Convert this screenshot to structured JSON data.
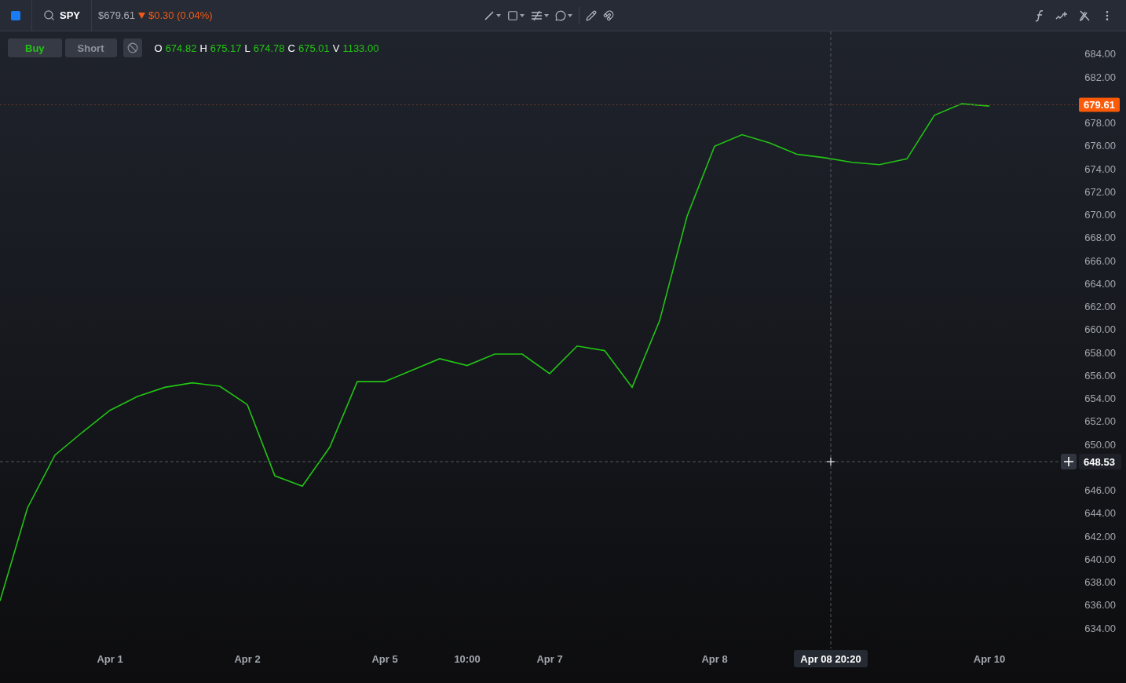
{
  "toolbar": {
    "symbol": "SPY",
    "price": "$679.61",
    "change": "$0.30 (0.04%)",
    "falling": true
  },
  "trade_buttons": [
    {
      "label": "Buy",
      "kind": "buy"
    },
    {
      "label": "Short",
      "kind": "short"
    }
  ],
  "ohlcv": [
    {
      "key": "O",
      "value": "674.82"
    },
    {
      "key": "H",
      "value": "675.17"
    },
    {
      "key": "L",
      "value": "674.78"
    },
    {
      "key": "C",
      "value": "675.01"
    },
    {
      "key": "V",
      "value": "1133.00"
    }
  ],
  "price_axis": {
    "current_price": "679.61",
    "crosshair_price": "648.53"
  },
  "time_axis": {
    "crosshair_time": "Apr 08 20:20"
  },
  "chart_data": {
    "type": "line",
    "categories": [
      null,
      null,
      null,
      null,
      "Apr 1",
      null,
      null,
      null,
      null,
      "Apr 2",
      null,
      null,
      null,
      null,
      "Apr 5",
      null,
      null,
      "10:00",
      null,
      null,
      "Apr 7",
      null,
      null,
      null,
      null,
      null,
      "Apr 8",
      null,
      null,
      null,
      null,
      null,
      null,
      null,
      null,
      null,
      "Apr 10"
    ],
    "series": [
      {
        "color": "#22c414",
        "values": [
          636.4,
          644.5,
          649.1,
          651.1,
          653.0,
          654.2,
          655.0,
          655.4,
          655.1,
          653.5,
          647.3,
          646.4,
          649.8,
          655.5,
          655.5,
          656.5,
          657.5,
          656.9,
          657.9,
          657.9,
          656.2,
          658.6,
          658.2,
          655.0,
          660.8,
          669.9,
          676.0,
          677.0,
          676.3,
          675.3,
          675.0,
          674.6,
          674.4,
          674.9,
          678.7,
          679.7,
          679.5
        ]
      }
    ],
    "ylim": [
      632.4,
      686
    ],
    "ref_lines": [
      {
        "axis": "y",
        "value": 679.61,
        "color": "#6b3a2a"
      },
      {
        "axis": "y",
        "value": 648.53,
        "color": "#555a63"
      }
    ],
    "yticks": [
      {
        "value": 634,
        "label": "634.00"
      },
      {
        "value": 636,
        "label": "636.00"
      },
      {
        "value": 638,
        "label": "638.00"
      },
      {
        "value": 640,
        "label": "640.00"
      },
      {
        "value": 642,
        "label": "642.00"
      },
      {
        "value": 644,
        "label": "644.00"
      },
      {
        "value": 646,
        "label": "646.00"
      },
      {
        "value": 650,
        "label": "650.00"
      },
      {
        "value": 652,
        "label": "652.00"
      },
      {
        "value": 654,
        "label": "654.00"
      },
      {
        "value": 656,
        "label": "656.00"
      },
      {
        "value": 658,
        "label": "658.00"
      },
      {
        "value": 660,
        "label": "660.00"
      },
      {
        "value": 662,
        "label": "662.00"
      },
      {
        "value": 664,
        "label": "664.00"
      },
      {
        "value": 666,
        "label": "666.00"
      },
      {
        "value": 668,
        "label": "668.00"
      },
      {
        "value": 670,
        "label": "670.00"
      },
      {
        "value": 672,
        "label": "672.00"
      },
      {
        "value": 674,
        "label": "674.00"
      },
      {
        "value": 676,
        "label": "676.00"
      },
      {
        "value": 678,
        "label": "678.00"
      },
      {
        "value": 682,
        "label": "682.00"
      },
      {
        "value": 684,
        "label": "684.00"
      }
    ]
  }
}
